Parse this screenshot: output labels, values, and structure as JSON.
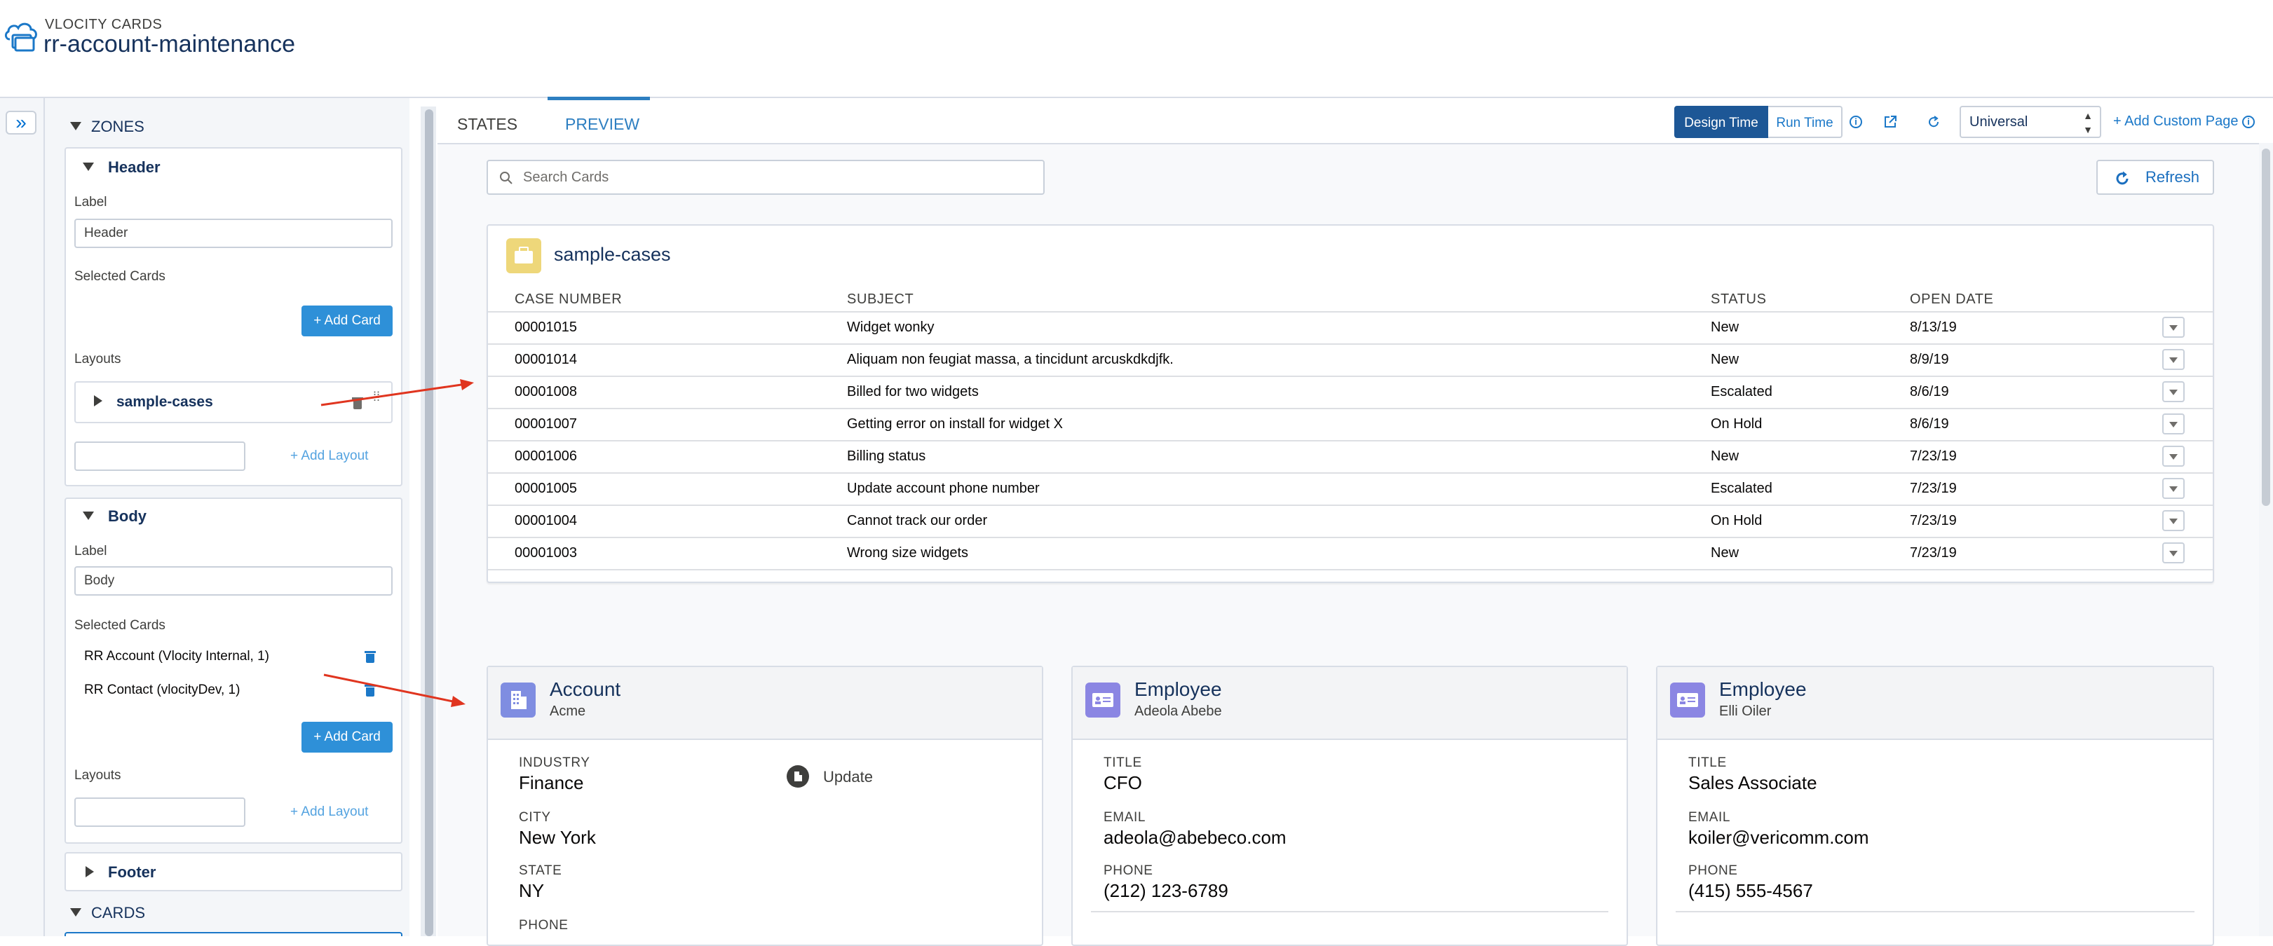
{
  "header": {
    "app_label": "VLOCITY CARDS",
    "title": "rr-account-maintenance"
  },
  "left_panel": {
    "zones_heading": "ZONES",
    "header_zone": {
      "title": "Header",
      "label_caption": "Label",
      "label_value": "Header",
      "selected_cards_caption": "Selected Cards",
      "add_card_label": "+ Add Card",
      "layouts_caption": "Layouts",
      "layout_item": "sample-cases",
      "add_layout_label": "+ Add Layout"
    },
    "body_zone": {
      "title": "Body",
      "label_caption": "Label",
      "label_value": "Body",
      "selected_cards_caption": "Selected Cards",
      "selected_cards": [
        "RR Account (Vlocity Internal, 1)",
        "RR Contact (vlocityDev, 1)"
      ],
      "add_card_label": "+ Add Card",
      "layouts_caption": "Layouts",
      "add_layout_label": "+ Add Layout"
    },
    "footer_zone": {
      "title": "Footer"
    },
    "cards_heading": "CARDS"
  },
  "tabs": {
    "states": "STATES",
    "preview": "PREVIEW",
    "active": "PREVIEW"
  },
  "toolbar": {
    "design_time": "Design Time",
    "run_time": "Run Time",
    "device_select": "Universal",
    "add_custom_page": "+ Add Custom Page",
    "refresh_label": "Refresh",
    "search_placeholder": "Search Cards",
    "mode_active": "Design Time"
  },
  "cases_card": {
    "title": "sample-cases",
    "columns": [
      "CASE NUMBER",
      "SUBJECT",
      "STATUS",
      "OPEN DATE"
    ],
    "rows": [
      [
        "00001015",
        "Widget wonky",
        "New",
        "8/13/19"
      ],
      [
        "00001014",
        "Aliquam non feugiat massa, a tincidunt arcuskdkdjfk.",
        "New",
        "8/9/19"
      ],
      [
        "00001008",
        "Billed for two widgets",
        "Escalated",
        "8/6/19"
      ],
      [
        "00001007",
        "Getting error on install for widget X",
        "On Hold",
        "8/6/19"
      ],
      [
        "00001006",
        "Billing status",
        "New",
        "7/23/19"
      ],
      [
        "00001005",
        "Update account phone number",
        "Escalated",
        "7/23/19"
      ],
      [
        "00001004",
        "Cannot track our order",
        "On Hold",
        "7/23/19"
      ],
      [
        "00001003",
        "Wrong size widgets",
        "New",
        "7/23/19"
      ]
    ]
  },
  "account_card": {
    "title": "Account",
    "subtitle": "Acme",
    "action": "Update",
    "fields": [
      {
        "label": "INDUSTRY",
        "value": "Finance"
      },
      {
        "label": "CITY",
        "value": "New York"
      },
      {
        "label": "STATE",
        "value": "NY"
      },
      {
        "label": "PHONE",
        "value": ""
      }
    ]
  },
  "employee_cards": [
    {
      "title": "Employee",
      "subtitle": "Adeola Abebe",
      "fields": [
        {
          "label": "TITLE",
          "value": "CFO"
        },
        {
          "label": "EMAIL",
          "value": "adeola@abebeco.com"
        },
        {
          "label": "PHONE",
          "value": "(212) 123-6789"
        }
      ]
    },
    {
      "title": "Employee",
      "subtitle": "Elli Oiler",
      "fields": [
        {
          "label": "TITLE",
          "value": "Sales Associate"
        },
        {
          "label": "EMAIL",
          "value": "koiler@vericomm.com"
        },
        {
          "label": "PHONE",
          "value": "(415) 555-4567"
        }
      ]
    }
  ],
  "icons": {
    "app": "cloud-cards-icon",
    "expand": "double-chevron-right-icon",
    "case": "briefcase-icon",
    "account": "building-icon",
    "employee": "contact-card-icon",
    "refresh": "refresh-icon",
    "search": "search-icon",
    "trash": "trash-icon"
  },
  "colors": {
    "brand_button": "#2e90d8",
    "case_icon": "#eed77a",
    "account_icon": "#7f8de1",
    "employee_icon": "#8b86e3",
    "annotation_arrow": "#e0351f"
  }
}
